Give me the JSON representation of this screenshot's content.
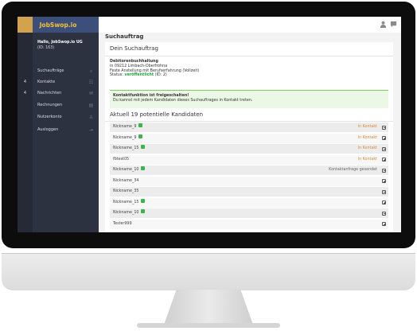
{
  "brand": {
    "name": "JobSwop.io"
  },
  "user": {
    "greeting": "Hallo, JobSwop.io UG",
    "id": "(ID: 163)"
  },
  "sidebar": {
    "items": [
      {
        "label": "Suchaufträge",
        "icon": "search-icon",
        "badge": ""
      },
      {
        "label": "Kontakte",
        "icon": "contacts-icon",
        "badge": "4"
      },
      {
        "label": "Nachrichten",
        "icon": "mail-icon",
        "badge": "4"
      },
      {
        "label": "Rechnungen",
        "icon": "invoice-icon",
        "badge": ""
      },
      {
        "label": "Nutzerkonto",
        "icon": "user-icon",
        "badge": ""
      },
      {
        "label": "Ausloggen",
        "icon": "logout-icon",
        "badge": ""
      }
    ]
  },
  "header": {
    "person_icon": "person-icon",
    "chat_icon": "chat-icon"
  },
  "page": {
    "title": "Suchauftrag"
  },
  "search_order": {
    "heading": "Dein Suchauftrag",
    "job_title": "Debitorenbuchhaltung",
    "location": "in 09212 Limbach-Oberfrohna",
    "employment": "Feste Anstellung mit Berufserfahrung (Vollzeit)",
    "status_label": "Status:",
    "status_value": "veröffentlicht",
    "status_id": "(ID: 2)"
  },
  "alert": {
    "title": "Kontaktfunktion ist freigeschalten!",
    "message": "Du kannst mit jedem Kandidaten dieses Suchauftrages in Kontakt treten."
  },
  "candidates": {
    "heading": "Aktuell 19 potentielle Kandidaten",
    "rows": [
      {
        "name": "Nickname_9",
        "verified": true,
        "status": "In Kontakt"
      },
      {
        "name": "Nickname_9",
        "verified": true,
        "status": "In Kontakt"
      },
      {
        "name": "Nickname_15",
        "verified": true,
        "status": "In Kontakt"
      },
      {
        "name": "fbtest05",
        "verified": false,
        "status": "In Kontakt"
      },
      {
        "name": "Nickname_10",
        "verified": true,
        "status": "Kontaktanfrage gesendet"
      },
      {
        "name": "Nickname_34",
        "verified": false,
        "status": ""
      },
      {
        "name": "Nickname_35",
        "verified": false,
        "status": ""
      },
      {
        "name": "Nickname_15",
        "verified": true,
        "status": ""
      },
      {
        "name": "Nickname_10",
        "verified": true,
        "status": ""
      },
      {
        "name": "Tester999",
        "verified": false,
        "status": ""
      }
    ]
  },
  "colors": {
    "sidebar": "#2d3240",
    "brand_bar": "#3c4e7a",
    "brand_text": "#f0c23c",
    "verified_green": "#3cb44b",
    "in_contact": "#d98a3a",
    "status_published": "#1fa437"
  }
}
